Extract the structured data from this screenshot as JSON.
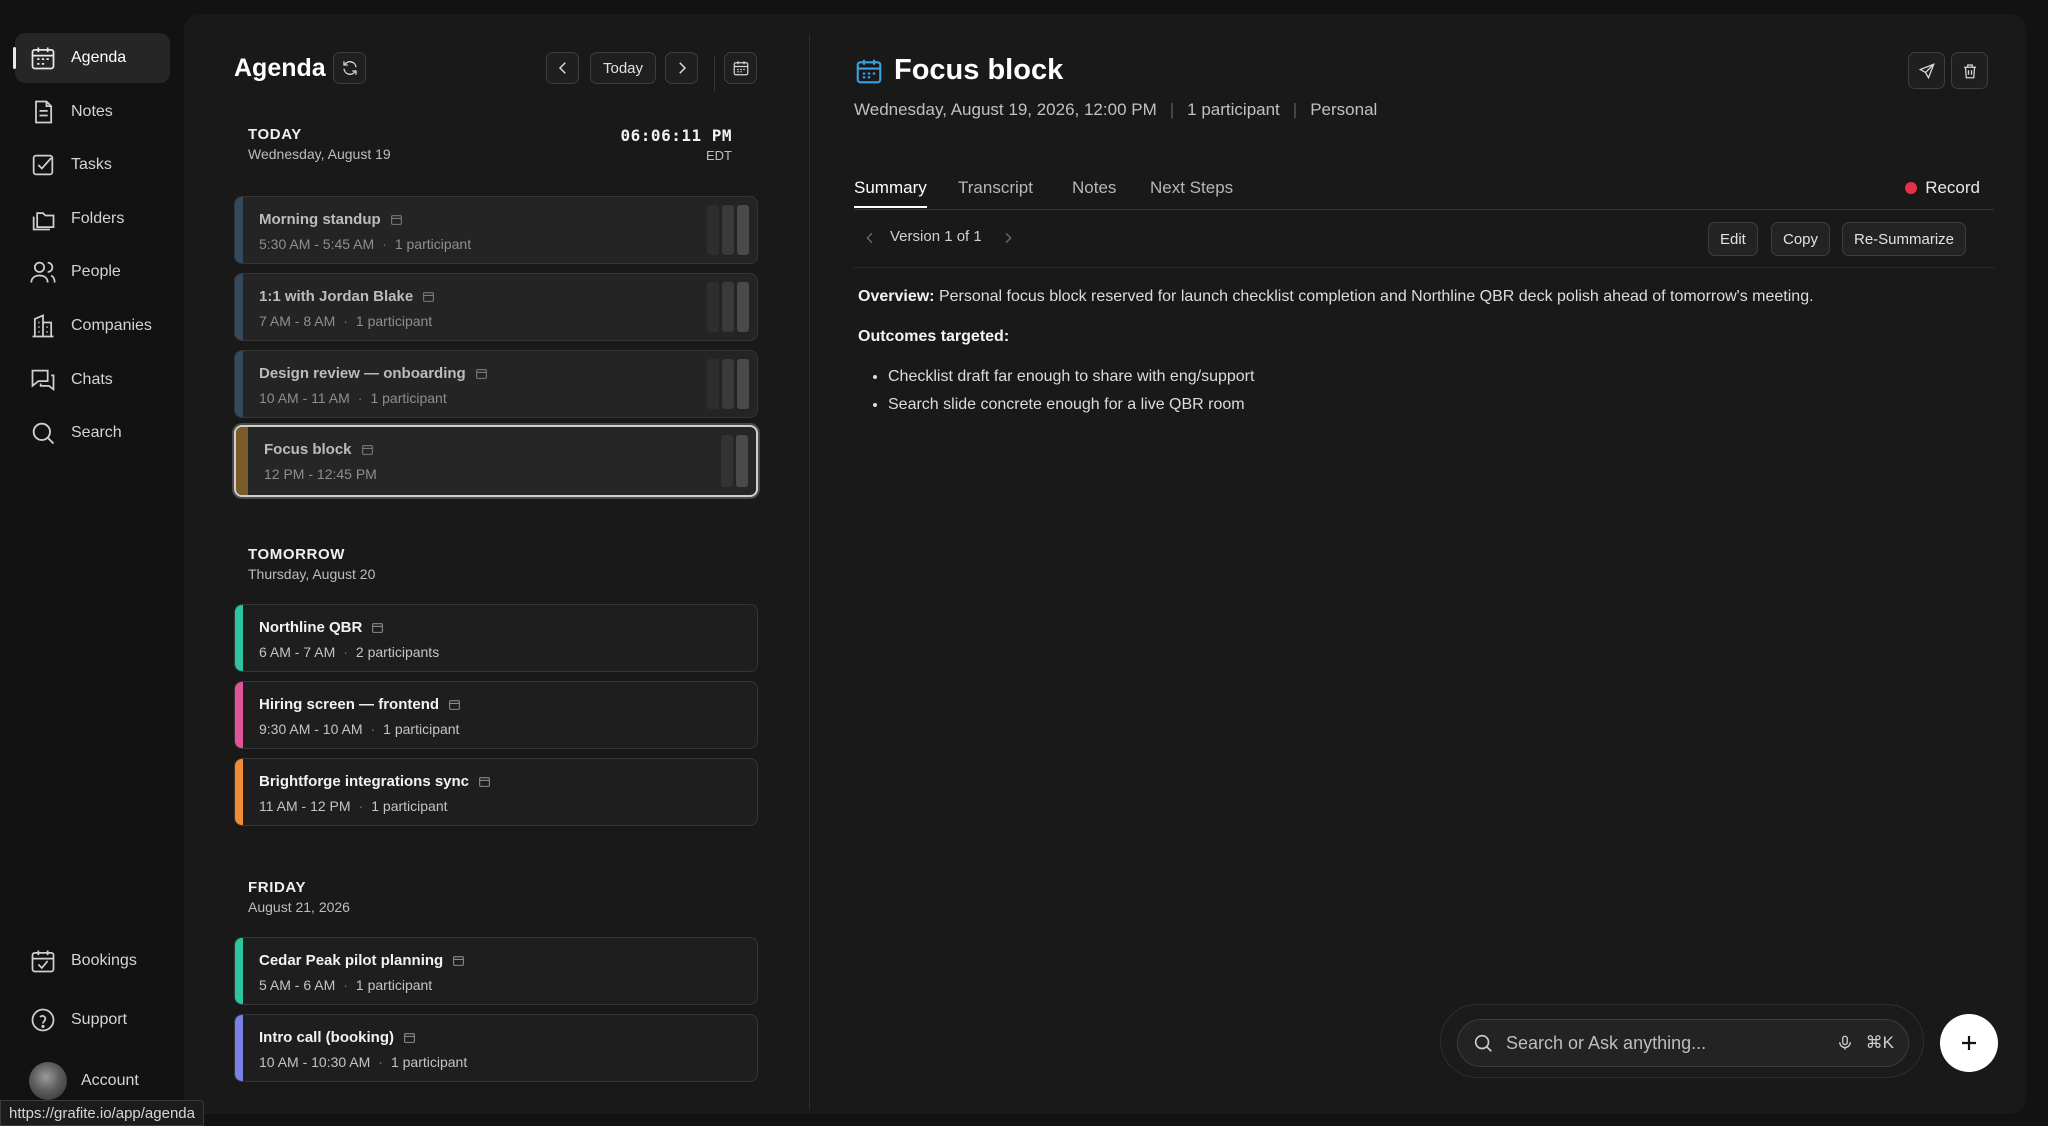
{
  "sidebar": {
    "items": [
      {
        "label": "Agenda",
        "icon": "calendar-icon",
        "active": true
      },
      {
        "label": "Notes",
        "icon": "document-icon"
      },
      {
        "label": "Tasks",
        "icon": "checkbox-icon"
      },
      {
        "label": "Folders",
        "icon": "folders-icon"
      },
      {
        "label": "People",
        "icon": "people-icon"
      },
      {
        "label": "Companies",
        "icon": "building-icon"
      },
      {
        "label": "Chats",
        "icon": "chat-icon"
      },
      {
        "label": "Search",
        "icon": "search-icon"
      }
    ],
    "bottom": [
      {
        "label": "Bookings",
        "icon": "calendar-check-icon"
      },
      {
        "label": "Support",
        "icon": "help-icon"
      },
      {
        "label": "Account",
        "icon": "avatar"
      }
    ]
  },
  "status_url": "https://grafite.io/app/agenda",
  "agenda": {
    "title": "Agenda",
    "today_label": "Today",
    "today": {
      "name": "TODAY",
      "date": "Wednesday, August 19",
      "time": "06:06:11 PM",
      "tz": "EDT"
    },
    "today_events": [
      {
        "title": "Morning standup",
        "time": "5:30 AM - 5:45 AM",
        "participants": "1 participant"
      },
      {
        "title": "1:1 with Jordan Blake",
        "time": "7 AM - 8 AM",
        "participants": "1 participant"
      },
      {
        "title": "Design review — onboarding",
        "time": "10 AM - 11 AM",
        "participants": "1 participant"
      },
      {
        "title": "Focus block",
        "time": "12 PM - 12:45 PM",
        "participants": ""
      }
    ],
    "tomorrow": {
      "name": "TOMORROW",
      "date": "Thursday, August 20"
    },
    "tomorrow_events": [
      {
        "title": "Northline QBR",
        "time": "6 AM - 7 AM",
        "participants": "2 participants"
      },
      {
        "title": "Hiring screen — frontend",
        "time": "9:30 AM - 10 AM",
        "participants": "1 participant"
      },
      {
        "title": "Brightforge integrations sync",
        "time": "11 AM - 12 PM",
        "participants": "1 participant"
      }
    ],
    "friday": {
      "name": "FRIDAY",
      "date": "August 21, 2026"
    },
    "friday_events": [
      {
        "title": "Cedar Peak pilot planning",
        "time": "5 AM - 6 AM",
        "participants": "1 participant"
      },
      {
        "title": "Intro call (booking)",
        "time": "10 AM - 10:30 AM",
        "participants": "1 participant"
      }
    ]
  },
  "colors": {
    "past_bar": "#3a4a5c",
    "focus_bar": "#7a5a2a",
    "teal": "#2ec4a0",
    "pink": "#e0559a",
    "orange": "#ef8c34",
    "purple": "#7d7fe8",
    "record_red": "#e5304a",
    "accent_blue": "#3aa0e0"
  },
  "detail": {
    "title": "Focus block",
    "datetime": "Wednesday, August 19, 2026, 12:00 PM",
    "participants": "1 participant",
    "category": "Personal",
    "tabs": [
      "Summary",
      "Transcript",
      "Notes",
      "Next Steps"
    ],
    "record_label": "Record",
    "version": "Version 1 of 1",
    "edit_label": "Edit",
    "copy_label": "Copy",
    "resummarize_label": "Re-Summarize",
    "overview_label": "Overview:",
    "overview_text": "Personal focus block reserved for launch checklist completion and Northline QBR deck polish ahead of tomorrow's meeting.",
    "outcomes_label": "Outcomes targeted:",
    "outcomes": [
      "Checklist draft far enough to share with eng/support",
      "Search slide concrete enough for a live QBR room"
    ]
  },
  "search": {
    "placeholder": "Search or Ask anything...",
    "shortcut": "⌘K"
  }
}
